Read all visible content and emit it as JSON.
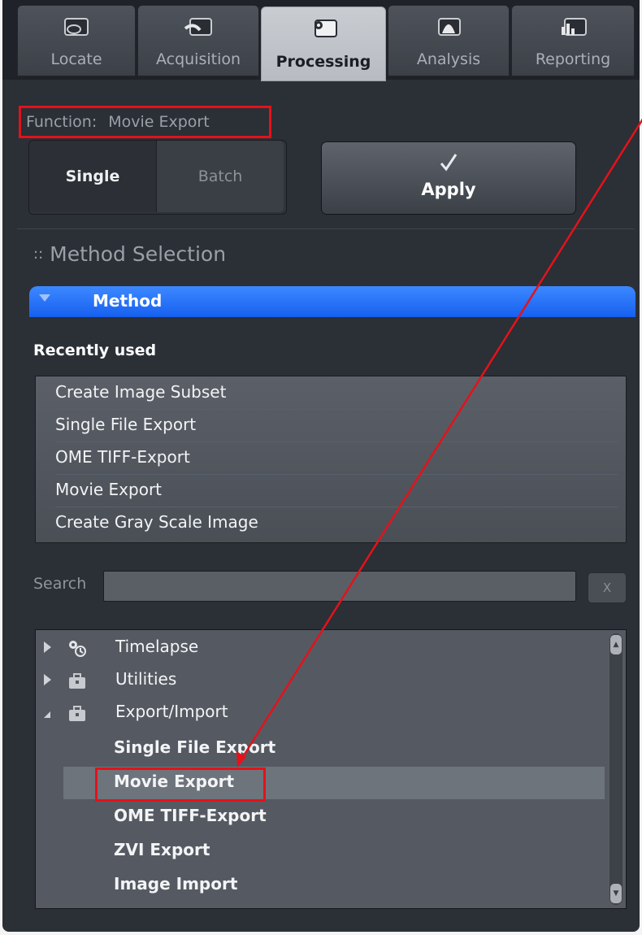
{
  "tabs": [
    {
      "label": "Locate",
      "icon": "locate-icon",
      "active": false
    },
    {
      "label": "Acquisition",
      "icon": "acquisition-icon",
      "active": false
    },
    {
      "label": "Processing",
      "icon": "processing-icon",
      "active": true
    },
    {
      "label": "Analysis",
      "icon": "analysis-icon",
      "active": false
    },
    {
      "label": "Reporting",
      "icon": "reporting-icon",
      "active": false
    }
  ],
  "function": {
    "label": "Function:",
    "value": "Movie Export"
  },
  "mode": {
    "single": "Single",
    "batch": "Batch",
    "selected": "Single"
  },
  "apply_label": "Apply",
  "section_title": "Method Selection",
  "method_header": "Method",
  "recent": {
    "title": "Recently used",
    "items": [
      "Create Image Subset",
      "Single File Export",
      "OME TIFF-Export",
      "Movie Export",
      "Create Gray Scale Image"
    ]
  },
  "search": {
    "label": "Search",
    "value": "",
    "clear_label": "X"
  },
  "tree": {
    "groups": [
      {
        "label": "Timelapse",
        "expanded": false,
        "icon": "timelapse-icon"
      },
      {
        "label": "Utilities",
        "expanded": false,
        "icon": "toolbox-icon"
      },
      {
        "label": "Export/Import",
        "expanded": true,
        "icon": "toolbox-icon"
      }
    ],
    "children": [
      "Single File Export",
      "Movie Export",
      "OME TIFF-Export",
      "ZVI Export",
      "Image Import"
    ],
    "selected": "Movie Export"
  },
  "colors": {
    "accent": "#1660f0",
    "highlight": "#e4121a"
  }
}
